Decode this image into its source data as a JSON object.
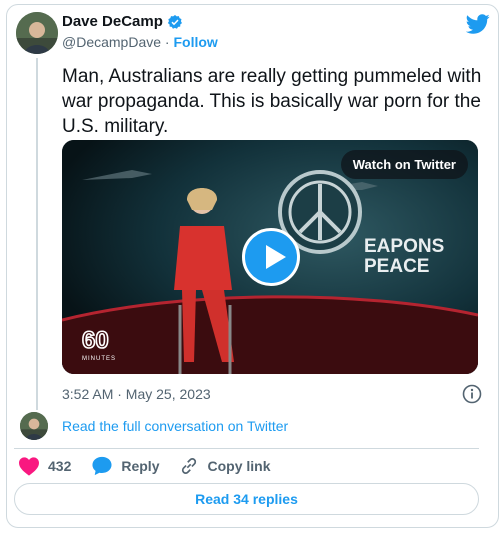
{
  "author": {
    "name": "Dave DeCamp",
    "handle": "@DecampDave",
    "separator": "·",
    "follow_label": "Follow"
  },
  "tweet": {
    "text": "Man, Australians are really getting pummeled with war propaganda. This is basically war porn for the U.S. military.",
    "timestamp": "3:52 AM · May 25, 2023"
  },
  "media": {
    "watch_label": "Watch on Twitter",
    "overlay_title_line1": "EAPONS",
    "overlay_title_line2": "PEACE",
    "show_logo_line1": "60",
    "show_logo_line2": "MINUTES"
  },
  "conversation": {
    "read_full_label": "Read the full conversation on Twitter"
  },
  "actions": {
    "likes_count": "432",
    "reply_label": "Reply",
    "copy_link_label": "Copy link"
  },
  "footer": {
    "read_replies_label": "Read 34 replies"
  },
  "colors": {
    "accent": "#1d9bf0",
    "like": "#f91880",
    "muted": "#536471",
    "border": "#cfd9de"
  },
  "icons": {
    "verified": "verified-badge-icon",
    "twitter": "twitter-bird-icon",
    "play": "play-icon",
    "info": "info-icon",
    "like": "heart-icon",
    "reply": "chat-bubble-icon",
    "copy": "link-icon"
  }
}
